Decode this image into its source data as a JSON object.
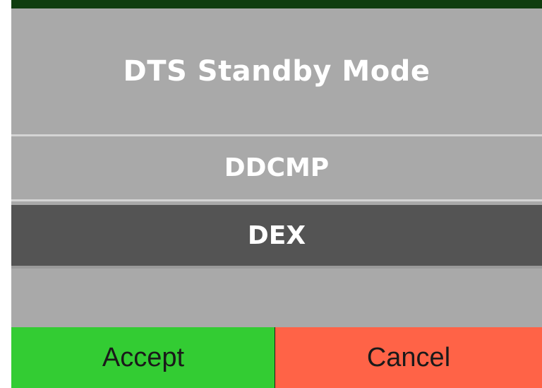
{
  "dialog": {
    "title": "DTS Standby Mode",
    "options": [
      {
        "label": "DDCMP",
        "selected": false
      },
      {
        "label": "DEX",
        "selected": true
      }
    ],
    "accept_label": "Accept",
    "cancel_label": "Cancel"
  },
  "colors": {
    "panel": "#a9a9a9",
    "selected_option": "#545454",
    "accept": "#33cc33",
    "cancel": "#ff6347",
    "top_bar": "#0f3d0f"
  }
}
